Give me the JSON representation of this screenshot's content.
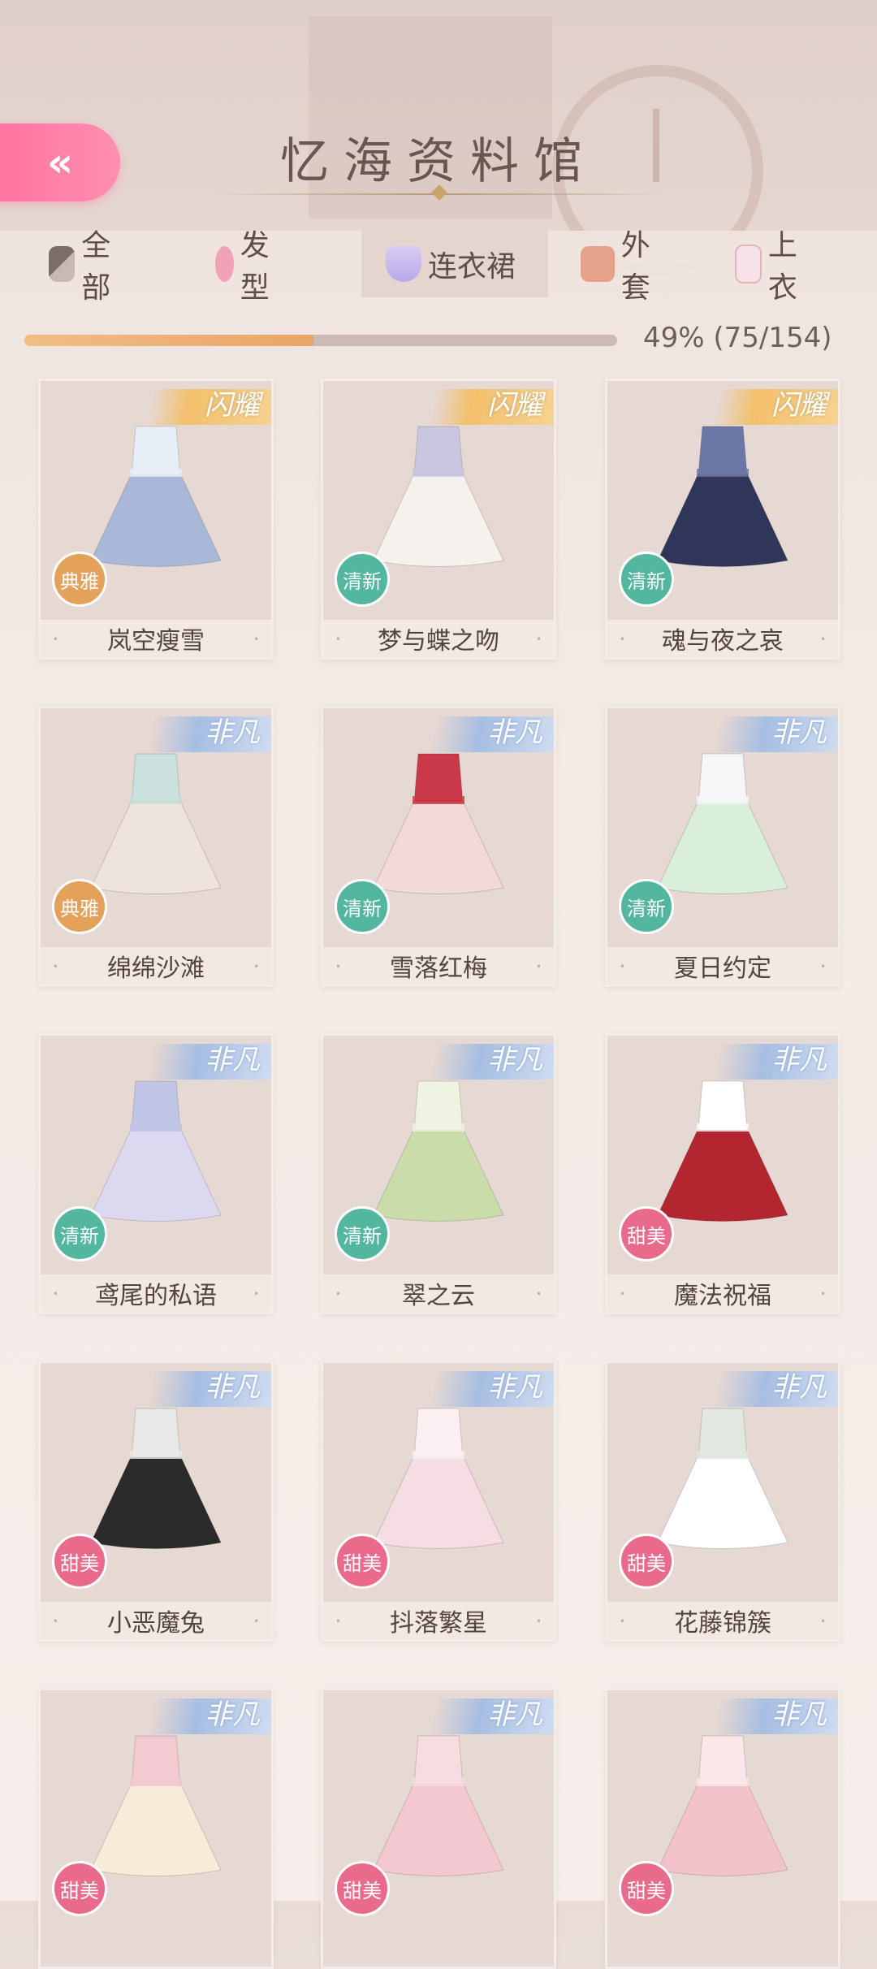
{
  "header": {
    "title": "忆海资料馆",
    "back_label": "«"
  },
  "tabs": [
    {
      "label": "全部",
      "icon": "grid-icon",
      "active": false
    },
    {
      "label": "发型",
      "icon": "hair-icon",
      "active": false
    },
    {
      "label": "连衣裙",
      "icon": "dress-icon",
      "active": true
    },
    {
      "label": "外套",
      "icon": "coat-icon",
      "active": false
    },
    {
      "label": "上衣",
      "icon": "top-icon",
      "active": false
    }
  ],
  "progress": {
    "text": "49% (75/154)",
    "fraction": 0.487
  },
  "items": [
    {
      "name": "岚空瘦雪",
      "rarity": "闪耀",
      "rarity_type": "gold",
      "style": "典雅",
      "style_type": "elegant",
      "colors": [
        "#a9b8d8",
        "#e8eef6"
      ]
    },
    {
      "name": "梦与蝶之吻",
      "rarity": "闪耀",
      "rarity_type": "gold",
      "style": "清新",
      "style_type": "fresh",
      "colors": [
        "#f5f2ee",
        "#c9c6e0"
      ]
    },
    {
      "name": "魂与夜之哀",
      "rarity": "闪耀",
      "rarity_type": "gold",
      "style": "清新",
      "style_type": "fresh",
      "colors": [
        "#2f3659",
        "#6b77a6"
      ]
    },
    {
      "name": "绵绵沙滩",
      "rarity": "非凡",
      "rarity_type": "blue",
      "style": "典雅",
      "style_type": "elegant",
      "colors": [
        "#eee4dc",
        "#c9e0dc"
      ]
    },
    {
      "name": "雪落红梅",
      "rarity": "非凡",
      "rarity_type": "blue",
      "style": "清新",
      "style_type": "fresh",
      "colors": [
        "#f2dada",
        "#c9394a"
      ]
    },
    {
      "name": "夏日约定",
      "rarity": "非凡",
      "rarity_type": "blue",
      "style": "清新",
      "style_type": "fresh",
      "colors": [
        "#d9efd9",
        "#f6f6f6"
      ]
    },
    {
      "name": "鸢尾的私语",
      "rarity": "非凡",
      "rarity_type": "blue",
      "style": "清新",
      "style_type": "fresh",
      "colors": [
        "#dcd8ef",
        "#c2c6e6"
      ]
    },
    {
      "name": "翠之云",
      "rarity": "非凡",
      "rarity_type": "blue",
      "style": "清新",
      "style_type": "fresh",
      "colors": [
        "#c9dcaa",
        "#eef3e2"
      ]
    },
    {
      "name": "魔法祝福",
      "rarity": "非凡",
      "rarity_type": "blue",
      "style": "甜美",
      "style_type": "sweet",
      "colors": [
        "#b3252f",
        "#ffffff"
      ]
    },
    {
      "name": "小恶魔兔",
      "rarity": "非凡",
      "rarity_type": "blue",
      "style": "甜美",
      "style_type": "sweet",
      "colors": [
        "#2a2a2a",
        "#e8e8e8"
      ]
    },
    {
      "name": "抖落繁星",
      "rarity": "非凡",
      "rarity_type": "blue",
      "style": "甜美",
      "style_type": "sweet",
      "colors": [
        "#f6dde3",
        "#fbeff1"
      ]
    },
    {
      "name": "花藤锦簇",
      "rarity": "非凡",
      "rarity_type": "blue",
      "style": "甜美",
      "style_type": "sweet",
      "colors": [
        "#ffffff",
        "#e0e8e0"
      ]
    },
    {
      "name": "",
      "rarity": "非凡",
      "rarity_type": "blue",
      "style": "甜美",
      "style_type": "sweet",
      "colors": [
        "#f6ecd8",
        "#f3c9d2"
      ]
    },
    {
      "name": "",
      "rarity": "非凡",
      "rarity_type": "blue",
      "style": "甜美",
      "style_type": "sweet",
      "colors": [
        "#f3c8d0",
        "#f7dde2"
      ]
    },
    {
      "name": "",
      "rarity": "非凡",
      "rarity_type": "blue",
      "style": "甜美",
      "style_type": "sweet",
      "colors": [
        "#f2c2cb",
        "#fbe7ea"
      ]
    }
  ]
}
